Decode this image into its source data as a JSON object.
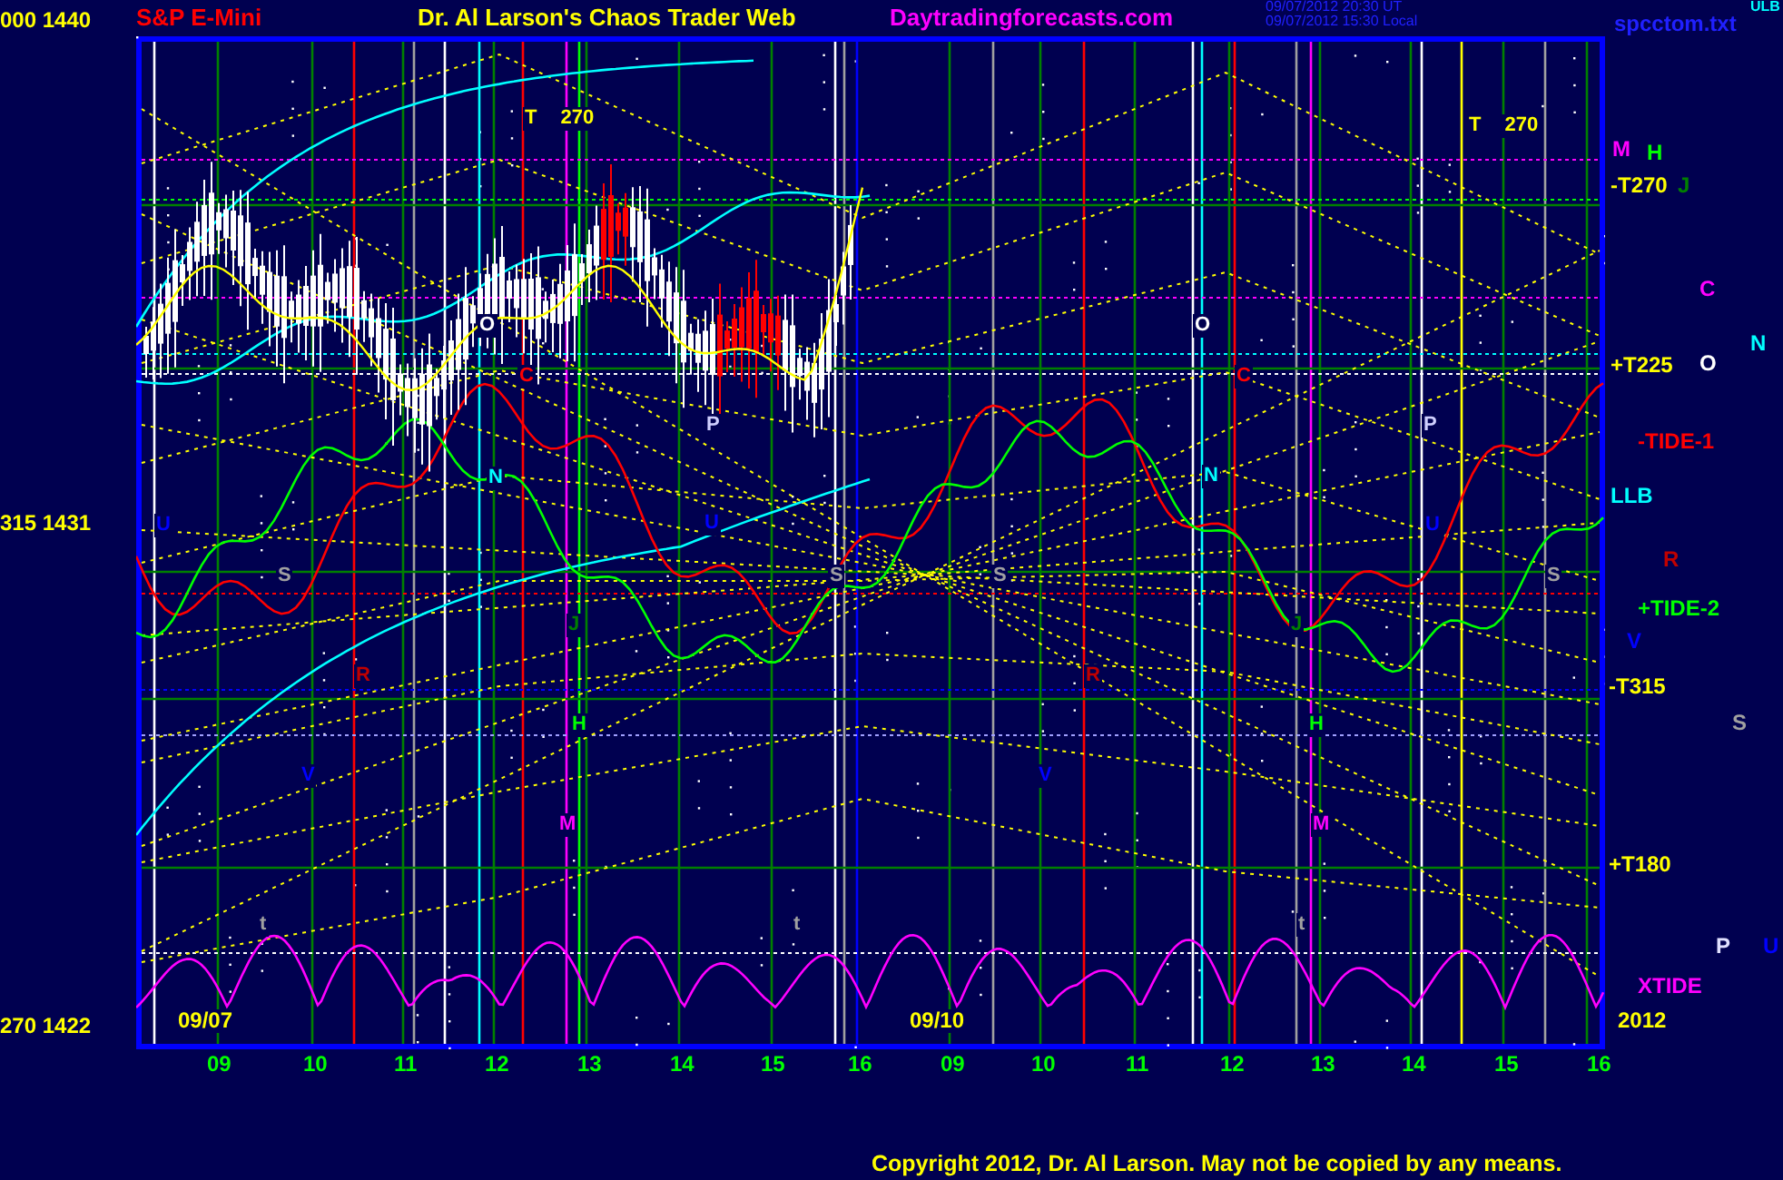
{
  "header": {
    "symbol": "S&P E-Mini",
    "title": "Dr. Al Larson's Chaos Trader Web",
    "site": "Daytradingforecasts.com",
    "timestamp_ut": "09/07/2012 20:30 UT",
    "timestamp_local": "09/07/2012 15:30 Local",
    "corner_label": "ULB",
    "file": "spcctom.txt"
  },
  "price_axis": [
    "000 1440",
    "315 1431",
    "270 1422"
  ],
  "plot_labels": [
    {
      "text": "T 270",
      "color": "#ffff00"
    },
    {
      "text": "T 270",
      "color": "#ffff00"
    },
    {
      "text": "O",
      "color": "#ffffff"
    },
    {
      "text": "O",
      "color": "#ffffff"
    },
    {
      "text": "C",
      "color": "#ff0000"
    },
    {
      "text": "C",
      "color": "#ff0000"
    },
    {
      "text": "P",
      "color": "#d0d0ff"
    },
    {
      "text": "P",
      "color": "#d0d0ff"
    },
    {
      "text": "N",
      "color": "#00ffff"
    },
    {
      "text": "N",
      "color": "#00ffff"
    },
    {
      "text": "U",
      "color": "#0000ff"
    },
    {
      "text": "U",
      "color": "#0000ff"
    },
    {
      "text": "U",
      "color": "#0000ff"
    },
    {
      "text": "S",
      "color": "#a0a0a0"
    },
    {
      "text": "S",
      "color": "#a0a0a0"
    },
    {
      "text": "S",
      "color": "#a0a0a0"
    },
    {
      "text": "S",
      "color": "#a0a0a0"
    },
    {
      "text": "J",
      "color": "#008000"
    },
    {
      "text": "J",
      "color": "#008000"
    },
    {
      "text": "R",
      "color": "#c00000"
    },
    {
      "text": "R",
      "color": "#c00000"
    },
    {
      "text": "H",
      "color": "#00ff00"
    },
    {
      "text": "H",
      "color": "#00ff00"
    },
    {
      "text": "V",
      "color": "#0000ff"
    },
    {
      "text": "V",
      "color": "#0000ff"
    },
    {
      "text": "M",
      "color": "#ff00ff"
    },
    {
      "text": "M",
      "color": "#ff00ff"
    },
    {
      "text": "t",
      "color": "#a0a0a0"
    },
    {
      "text": "t",
      "color": "#a0a0a0"
    },
    {
      "text": "t",
      "color": "#a0a0a0"
    }
  ],
  "date_labels": [
    "09/07",
    "09/10"
  ],
  "right_labels": [
    {
      "text": "M",
      "color": "#ff00ff"
    },
    {
      "text": "H",
      "color": "#00ff00"
    },
    {
      "text": "-T270",
      "color": "#ffff00"
    },
    {
      "text": "J",
      "color": "#008000"
    },
    {
      "text": "C",
      "color": "#ff00ff"
    },
    {
      "text": "N",
      "color": "#00ffff"
    },
    {
      "text": "+T225",
      "color": "#ffff00"
    },
    {
      "text": "O",
      "color": "#ffffff"
    },
    {
      "text": "-TIDE-1",
      "color": "#ff0000"
    },
    {
      "text": "LLB",
      "color": "#00ffff"
    },
    {
      "text": "R",
      "color": "#c00000"
    },
    {
      "text": "+TIDE-2",
      "color": "#00ff00"
    },
    {
      "text": "V",
      "color": "#0000ff"
    },
    {
      "text": "-T315",
      "color": "#ffff00"
    },
    {
      "text": "S",
      "color": "#a0a0a0"
    },
    {
      "text": "+T180",
      "color": "#ffff00"
    },
    {
      "text": "P",
      "color": "#e0e0ff"
    },
    {
      "text": "U",
      "color": "#0000ff"
    },
    {
      "text": "XTIDE",
      "color": "#ff00ff"
    },
    {
      "text": "2012",
      "color": "#ffff00"
    }
  ],
  "hour_labels": [
    "09",
    "10",
    "11",
    "12",
    "13",
    "14",
    "15",
    "16",
    "09",
    "10",
    "11",
    "12",
    "13",
    "14",
    "15",
    "16"
  ],
  "copyright": "Copyright 2012, Dr. Al Larson. May not be copied by any means."
}
